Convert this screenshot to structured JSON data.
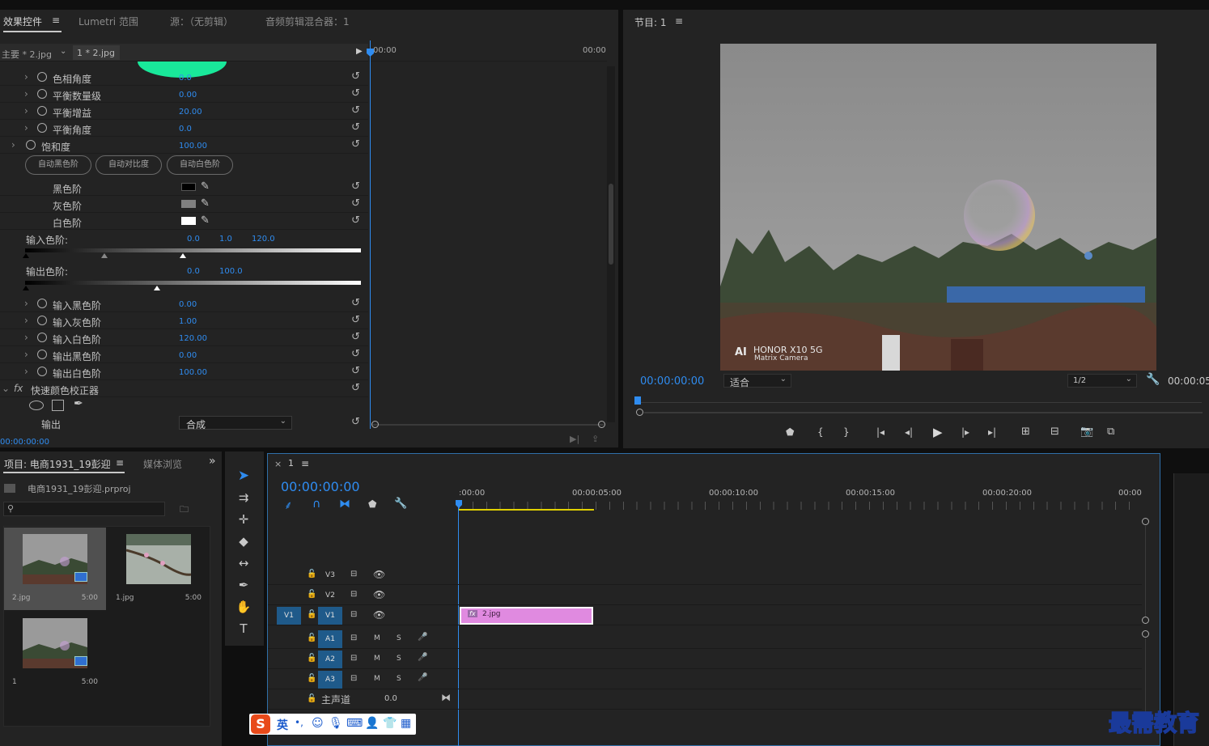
{
  "effect_controls": {
    "tabs": [
      "效果控件",
      "Lumetri 范围",
      "源：（无剪辑）",
      "音频剪辑混合器：1"
    ],
    "menu_icon": "≡",
    "master_label": "主要 * 2.jpg",
    "clip_label": "1 * 2.jpg",
    "time_start": "00:00",
    "time_end": "00:00",
    "params": [
      {
        "label": "色相角度",
        "value": "0.0"
      },
      {
        "label": "平衡数量级",
        "value": "0.00"
      },
      {
        "label": "平衡增益",
        "value": "20.00"
      },
      {
        "label": "平衡角度",
        "value": "0.0"
      },
      {
        "label": "饱和度",
        "value": "100.00"
      }
    ],
    "auto_buttons": [
      "自动黑色阶",
      "自动对比度",
      "自动白色阶"
    ],
    "levels": [
      {
        "label": "黑色阶",
        "color": "#000000"
      },
      {
        "label": "灰色阶",
        "color": "#808080"
      },
      {
        "label": "白色阶",
        "color": "#ffffff"
      }
    ],
    "input_levels_label": "输入色阶:",
    "input_levels_values": [
      "0.0",
      "1.0",
      "120.0"
    ],
    "output_levels_label": "输出色阶:",
    "output_levels_values": [
      "0.0",
      "100.0"
    ],
    "params2": [
      {
        "label": "输入黑色阶",
        "value": "0.00"
      },
      {
        "label": "输入灰色阶",
        "value": "1.00"
      },
      {
        "label": "输入白色阶",
        "value": "120.00"
      },
      {
        "label": "输出黑色阶",
        "value": "0.00"
      },
      {
        "label": "输出白色阶",
        "value": "100.00"
      }
    ],
    "effect_name": "快速颜色校正器",
    "fx_label": "fx",
    "output_label": "输出",
    "output_value": "合成",
    "current_time": "00:00:00:00"
  },
  "program": {
    "title": "节目: 1",
    "menu_icon": "≡",
    "timecode": "00:00:00:00",
    "fit": "适合",
    "resolution": "1/2",
    "timecode_right": "00:00:05",
    "watermark_brand": "HONOR X10 5G",
    "watermark_sub": "Matrix Camera",
    "watermark_ai": "AI"
  },
  "project": {
    "title": "项目: 电商1931_19彭迎",
    "menu_icon": "≡",
    "media_browser": "媒体浏览",
    "more": "»",
    "file": "电商1931_19彭迎.prproj",
    "search_placeholder": "",
    "items": [
      {
        "name": "2.jpg",
        "duration": "5:00"
      },
      {
        "name": "1.jpg",
        "duration": "5:00"
      },
      {
        "name": "1",
        "duration": "5:00"
      }
    ]
  },
  "timeline": {
    "close": "×",
    "seq_name": "1",
    "menu_icon": "≡",
    "timecode": "00:00:00:00",
    "ruler": [
      ":00:00",
      "00:00:05:00",
      "00:00:10:00",
      "00:00:15:00",
      "00:00:20:00",
      "00:00"
    ],
    "tracks": [
      {
        "name": "V3",
        "type": "video",
        "src": ""
      },
      {
        "name": "V2",
        "type": "video",
        "src": ""
      },
      {
        "name": "V1",
        "type": "video",
        "src": "V1"
      },
      {
        "name": "A1",
        "type": "audio",
        "src": ""
      },
      {
        "name": "A2",
        "type": "audio",
        "src": ""
      },
      {
        "name": "A3",
        "type": "audio",
        "src": ""
      }
    ],
    "mute": "M",
    "solo": "S",
    "master_label": "主声道",
    "master_value": "0.0",
    "clip_name": "2.jpg",
    "clip_fx": "fx",
    "clip_color": "#e08ae0"
  },
  "ime": {
    "logo": "S",
    "lang": "英",
    "punct": "•,"
  },
  "brand_watermark": "最需教育"
}
